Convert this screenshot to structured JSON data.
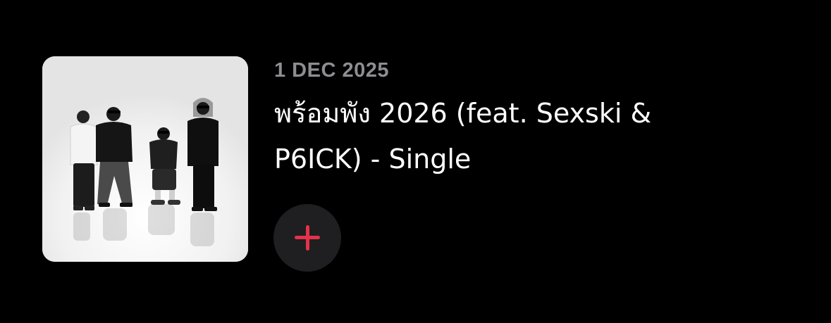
{
  "release": {
    "date": "1 DEC 2025",
    "title": "พร้อมพัง 2026 (feat. Sexski & P6ICK) - Single"
  },
  "artwork": {
    "icon": "album-artwork-image"
  },
  "add_button": {
    "icon": "plus-icon",
    "accent_color": "#e5324a",
    "background_color": "#1f1f21"
  },
  "colors": {
    "background": "#000000",
    "date_text": "#8d8d92",
    "title_text": "#ffffff"
  }
}
